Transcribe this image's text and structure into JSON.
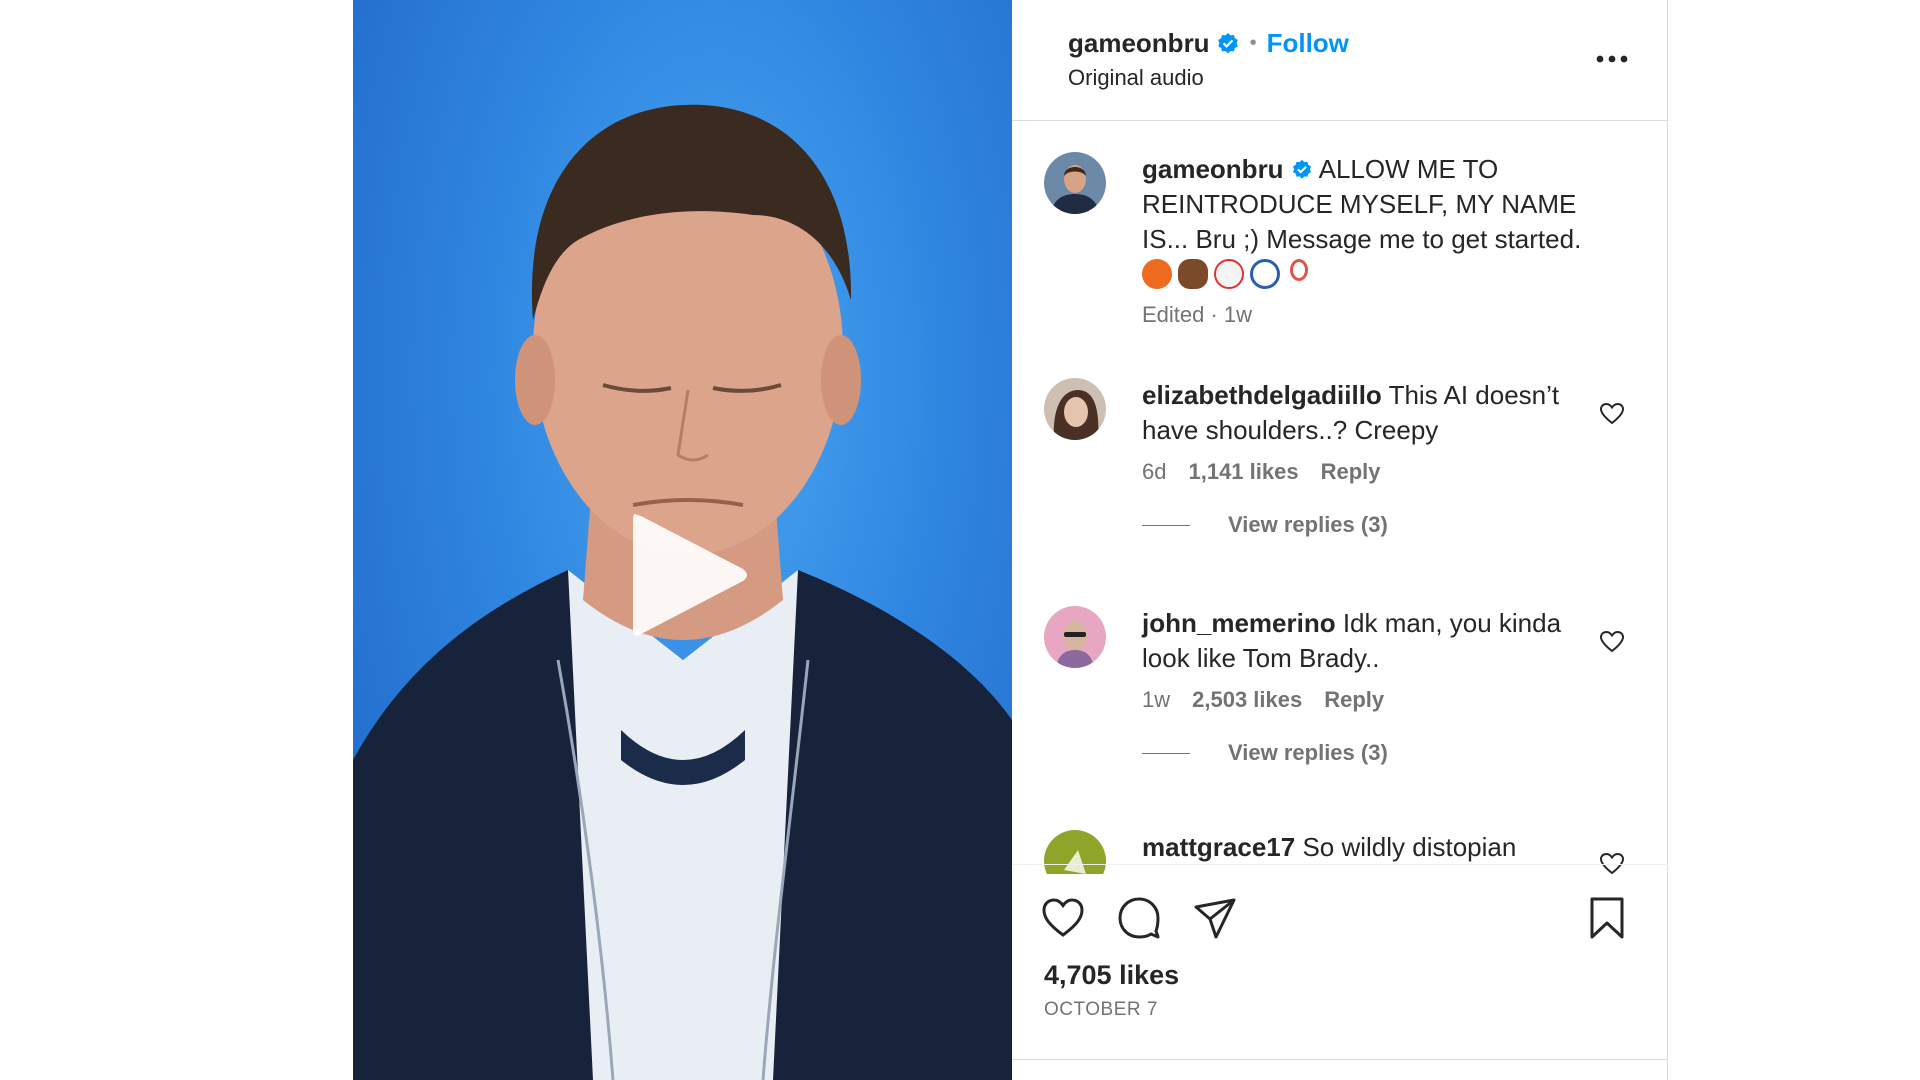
{
  "header": {
    "username": "gameonbru",
    "separator": "•",
    "follow_label": "Follow",
    "audio": "Original audio"
  },
  "caption": {
    "username": "gameonbru",
    "text": "ALLOW ME TO REINTRODUCE MYSELF, MY NAME IS... Bru ;) Message me to get started.",
    "emojis": [
      "basketball",
      "american-football",
      "baseball",
      "soccer-ball",
      "badminton"
    ],
    "meta": "Edited · 1w"
  },
  "comments": [
    {
      "username": "elizabethdelgadiillo",
      "text": "This AI doesn’t have shoulders..? Creepy",
      "age": "6d",
      "likes": "1,141 likes",
      "reply_label": "Reply",
      "view_replies": "View replies (3)"
    },
    {
      "username": "john_memerino",
      "text": "Idk man, you kinda look like Tom Brady..",
      "age": "1w",
      "likes": "2,503 likes",
      "reply_label": "Reply",
      "view_replies": "View replies (3)"
    },
    {
      "username": "mattgrace17",
      "text": "So wildly distopian"
    }
  ],
  "actions": {
    "likes": "4,705 likes",
    "date": "OCTOBER 7"
  },
  "colors": {
    "accent": "#0095f6",
    "video_background": "#2f86e0",
    "muted_text": "#737373"
  }
}
